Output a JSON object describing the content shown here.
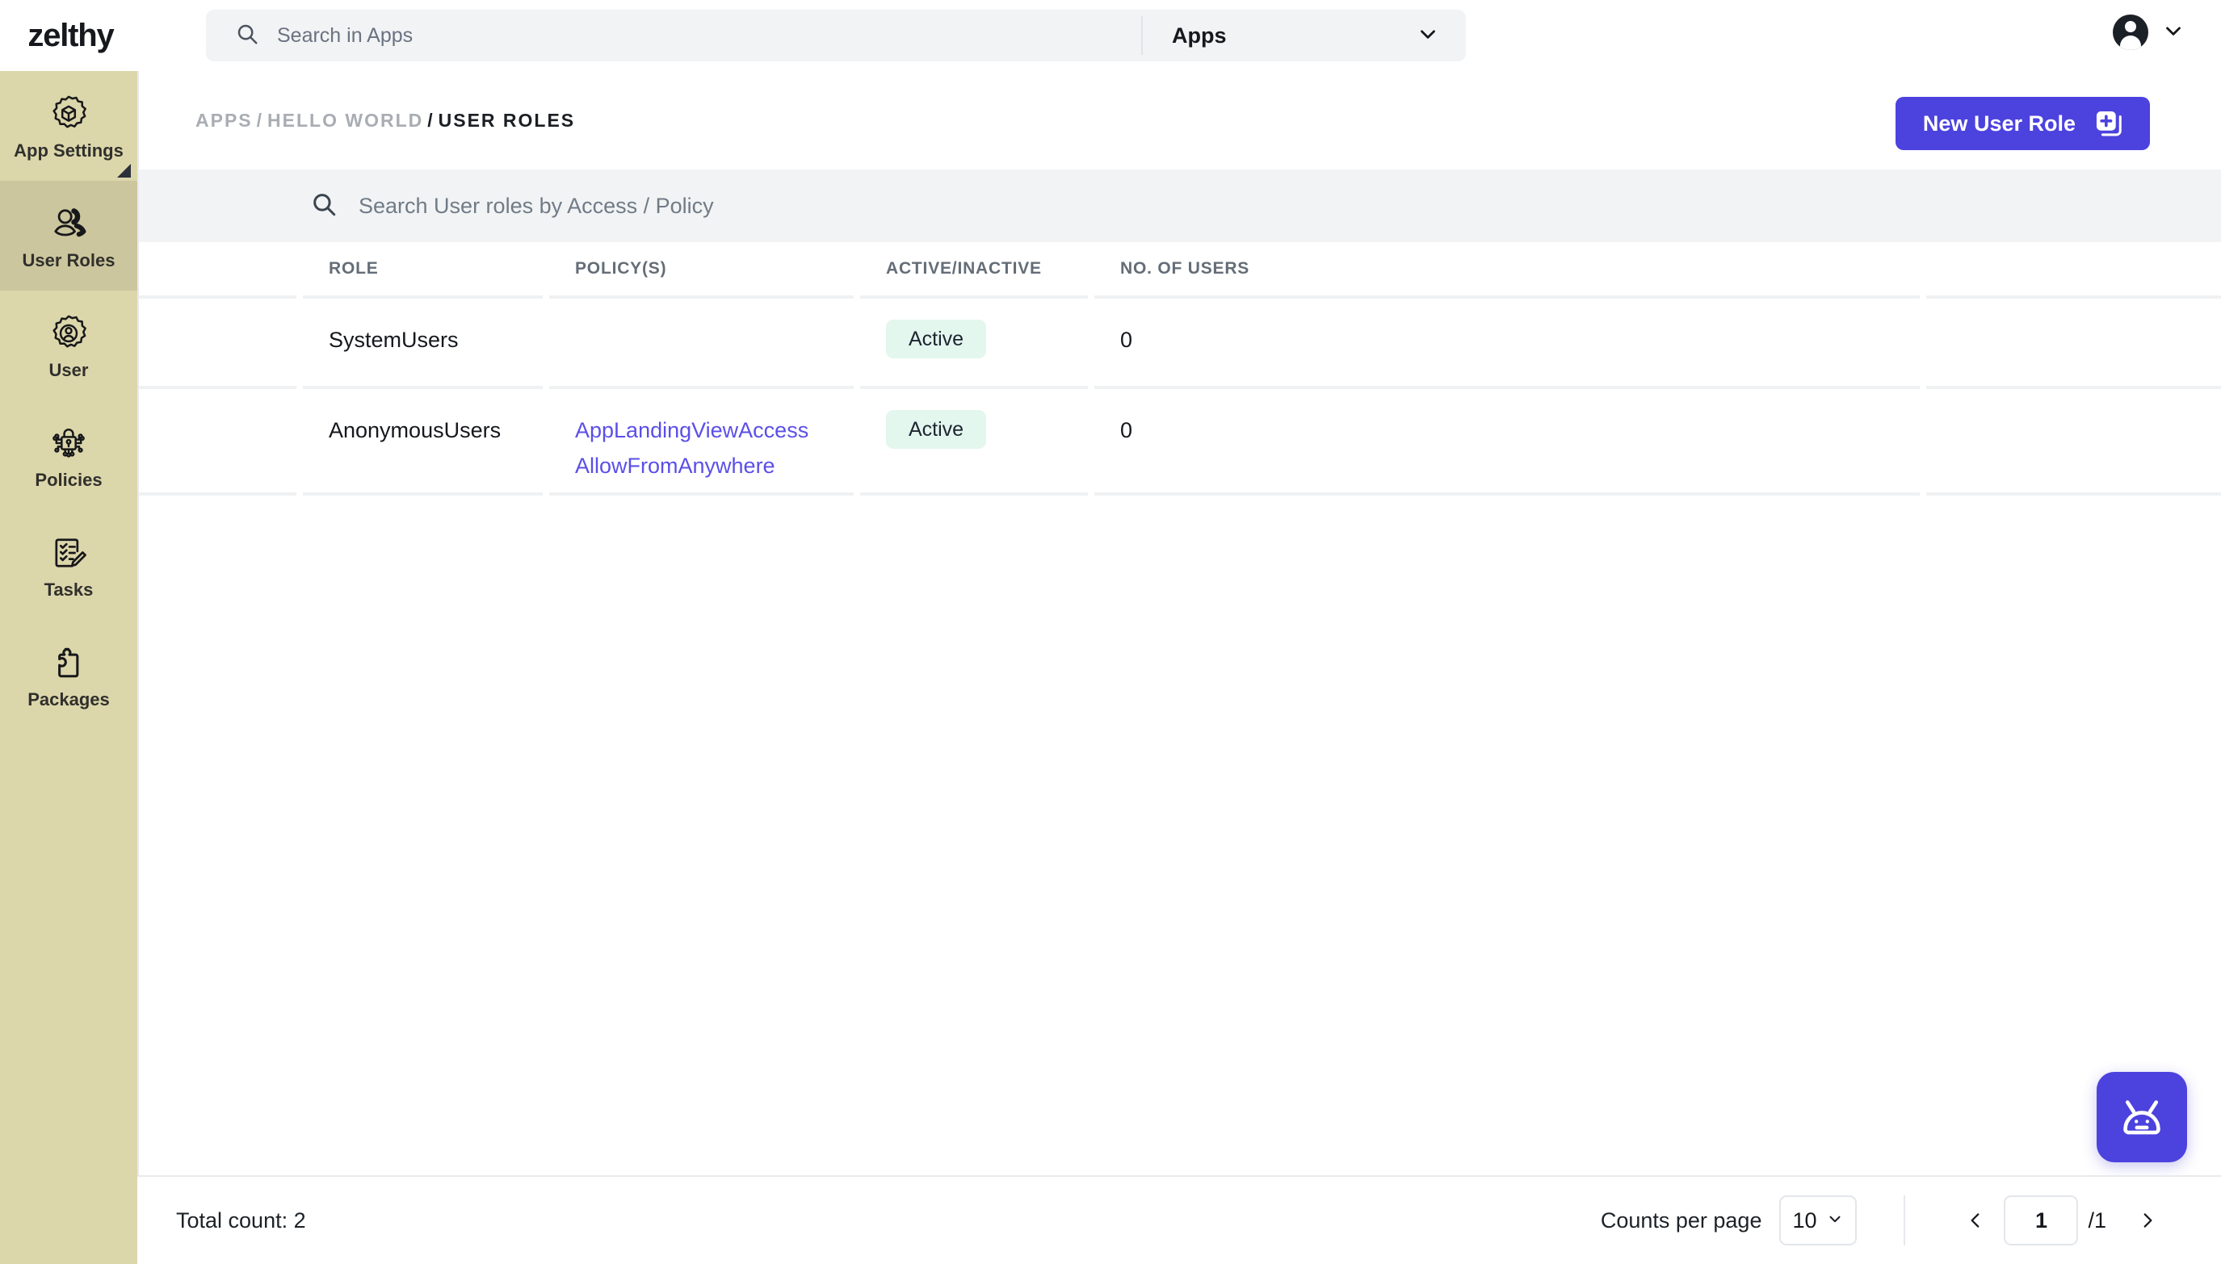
{
  "brand": {
    "name": "zelthy"
  },
  "topbar": {
    "search": {
      "placeholder": "Search in Apps",
      "value": "",
      "icon": "search-icon"
    },
    "scope": {
      "label": "Apps",
      "icon": "chevron-down-icon"
    },
    "profile": {
      "avatar_icon": "user-avatar-icon",
      "caret_icon": "chevron-down-icon"
    }
  },
  "sidebar": {
    "items": [
      {
        "label": "App Settings",
        "icon": "gear-cube-icon",
        "active": false,
        "corner_marker": true
      },
      {
        "label": "User Roles",
        "icon": "users-group-icon",
        "active": true,
        "corner_marker": false
      },
      {
        "label": "User",
        "icon": "gear-user-icon",
        "active": false,
        "corner_marker": false
      },
      {
        "label": "Policies",
        "icon": "lock-network-icon",
        "active": false,
        "corner_marker": false
      },
      {
        "label": "Tasks",
        "icon": "checklist-pencil-icon",
        "active": false,
        "corner_marker": false
      },
      {
        "label": "Packages",
        "icon": "puzzle-piece-icon",
        "active": false,
        "corner_marker": false
      }
    ]
  },
  "breadcrumb": {
    "items": [
      {
        "label": "APPS",
        "current": false
      },
      {
        "label": "HELLO WORLD",
        "current": false
      },
      {
        "label": "USER ROLES",
        "current": true
      }
    ],
    "separator": "/"
  },
  "actions": {
    "new_user_role": {
      "label": "New User Role",
      "icon": "add-square-duplicate-icon",
      "color": "#4c42de"
    }
  },
  "table_search": {
    "placeholder": "Search User roles by Access / Policy",
    "value": "",
    "icon": "search-icon"
  },
  "table": {
    "columns": [
      "ROLE",
      "POLICY(S)",
      "ACTIVE/INACTIVE",
      "NO. OF USERS"
    ],
    "rows": [
      {
        "role": "SystemUsers",
        "policies": [],
        "status": "Active",
        "users": "0"
      },
      {
        "role": "AnonymousUsers",
        "policies": [
          "AppLandingViewAccess",
          "AllowFromAnywhere"
        ],
        "status": "Active",
        "users": "0"
      }
    ]
  },
  "footer": {
    "total_count": "Total count: 2",
    "counts_per_page_label": "Counts per page",
    "counts_per_page_value": "10",
    "prev_icon": "chevron-left-icon",
    "next_icon": "chevron-right-icon",
    "current_page": "1",
    "total_pages": "/1"
  },
  "bot": {
    "label": "bot-assistant",
    "icon": "robot-icon",
    "color": "#4c42de"
  },
  "colors": {
    "sidebar_bg": "#dcd6ab",
    "sidebar_active_bg": "#ccc69e",
    "accent": "#4c42de",
    "link": "#5b4fe8",
    "badge_bg": "#e3f7ee",
    "search_bg": "#f1f3f5"
  }
}
